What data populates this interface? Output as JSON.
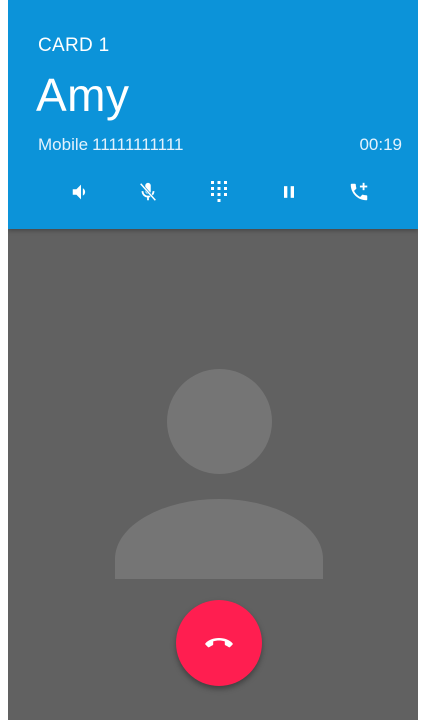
{
  "call": {
    "sim_label": "CARD 1",
    "caller_name": "Amy",
    "number_type": "Mobile",
    "number": "11111111111",
    "duration": "00:19"
  },
  "controls": [
    {
      "name": "speaker-icon"
    },
    {
      "name": "mute-icon"
    },
    {
      "name": "dialpad-icon"
    },
    {
      "name": "hold-icon"
    },
    {
      "name": "add-call-icon"
    }
  ],
  "colors": {
    "header": "#0C93D9",
    "background": "#616161",
    "avatar": "#757575",
    "end_call": "#FF1E50"
  }
}
